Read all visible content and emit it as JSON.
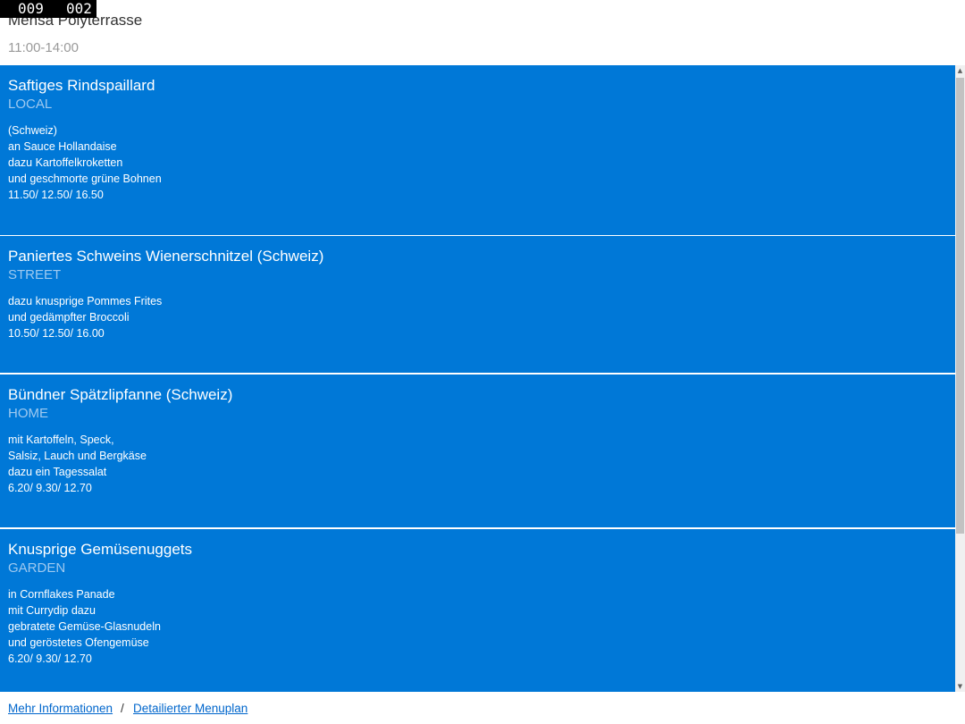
{
  "counter": {
    "left": "009",
    "right": "002"
  },
  "mensa": {
    "name": "Mensa Polyterrasse",
    "hours": "11:00-14:00"
  },
  "menus": [
    {
      "title": "Saftiges Rindspaillard",
      "line": "LOCAL",
      "description": [
        "(Schweiz)",
        "an Sauce Hollandaise",
        "dazu Kartoffelkroketten",
        "und geschmorte grüne Bohnen",
        "11.50/ 12.50/ 16.50"
      ]
    },
    {
      "title": "Paniertes Schweins Wienerschnitzel (Schweiz)",
      "line": "STREET",
      "description": [
        "dazu knusprige Pommes Frites",
        "und gedämpfter Broccoli",
        "10.50/ 12.50/ 16.00"
      ]
    },
    {
      "title": "Bündner Spätzlipfanne (Schweiz)",
      "line": "HOME",
      "description": [
        "mit Kartoffeln, Speck,",
        "Salsiz, Lauch und Bergkäse",
        "dazu ein Tagessalat",
        "6.20/ 9.30/ 12.70"
      ]
    },
    {
      "title": "Knusprige Gemüsenuggets",
      "line": "GARDEN",
      "description": [
        "in Cornflakes Panade",
        "mit Currydip dazu",
        "gebratete Gemüse-Glasnudeln",
        "und geröstetes Ofengemüse",
        "6.20/ 9.30/ 12.70"
      ]
    }
  ],
  "footer": {
    "more_info": "Mehr Informationen",
    "separator": "/",
    "detailed_menu": "Detailierter Menuplan"
  },
  "scrollbar": {
    "up_arrow": "▲",
    "down_arrow": "▼"
  }
}
